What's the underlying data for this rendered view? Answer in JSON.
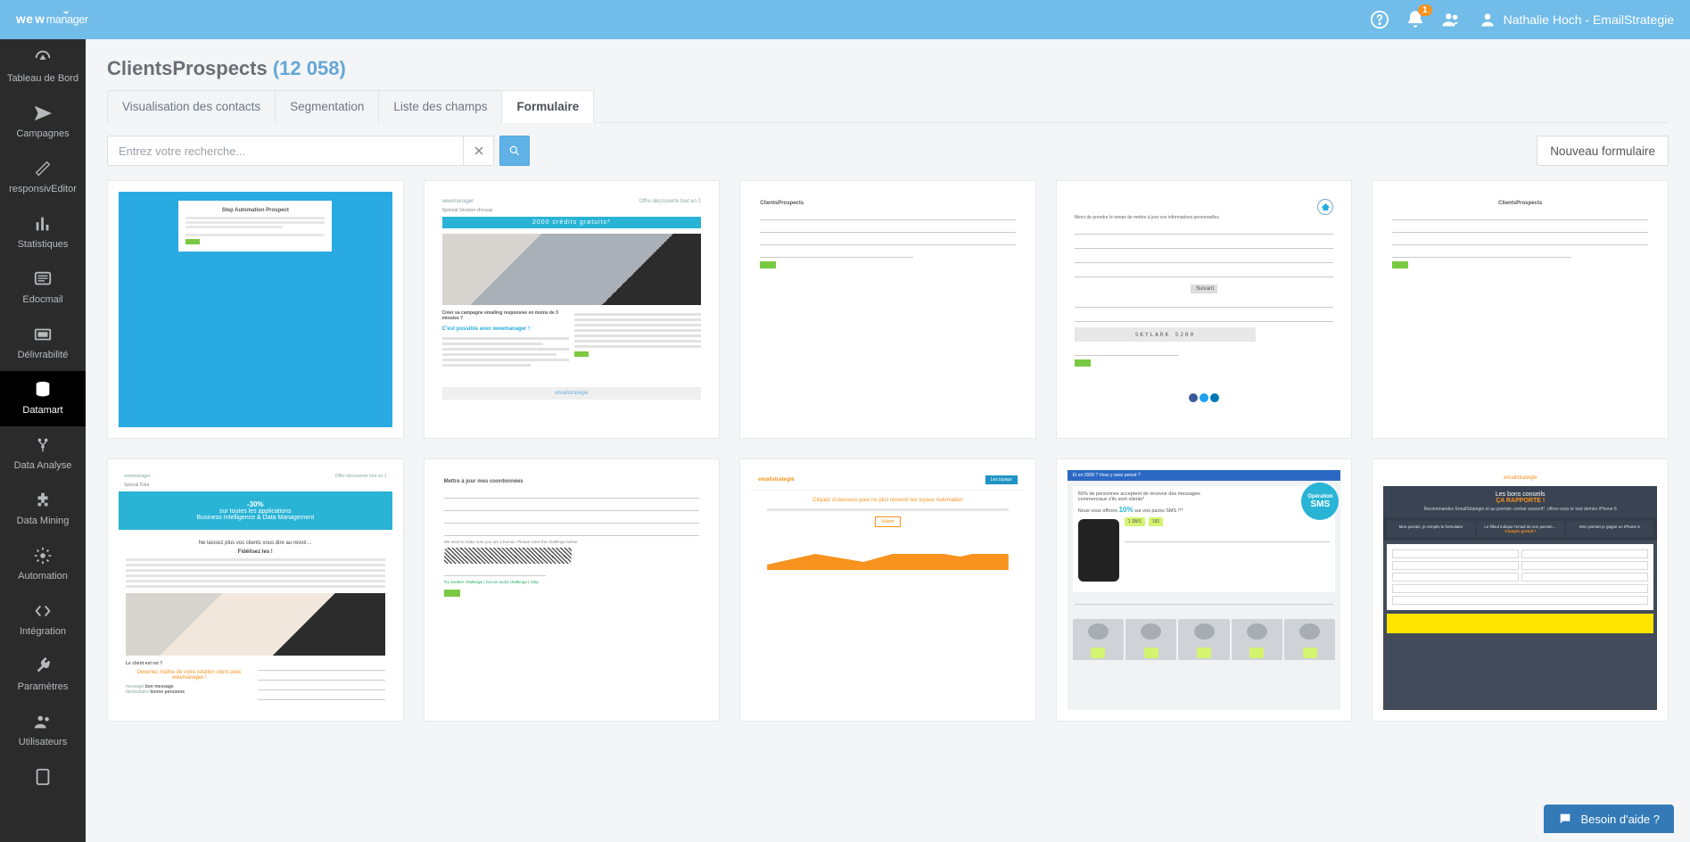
{
  "brand": "wewmanager",
  "user": {
    "name": "Nathalie Hoch - EmailStrategie"
  },
  "notifications": {
    "badge": "1"
  },
  "sidebar": {
    "items": [
      {
        "label": "Tableau de Bord"
      },
      {
        "label": "Campagnes"
      },
      {
        "label": "responsivEditor"
      },
      {
        "label": "Statistiques"
      },
      {
        "label": "Edocmail"
      },
      {
        "label": "Délivrabilité"
      },
      {
        "label": "Datamart"
      },
      {
        "label": "Data Analyse"
      },
      {
        "label": "Data Mining"
      },
      {
        "label": "Automation"
      },
      {
        "label": "Intégration"
      },
      {
        "label": "Paramètres"
      },
      {
        "label": "Utilisateurs"
      }
    ],
    "activeIndex": 6
  },
  "page": {
    "title": "ClientsProspects",
    "count": "(12 058)",
    "tabs": [
      "Visualisation des contacts",
      "Segmentation",
      "Liste des champs",
      "Formulaire"
    ],
    "activeTab": 3
  },
  "search": {
    "placeholder": "Entrez votre recherche..."
  },
  "buttons": {
    "new_form": "Nouveau formulaire"
  },
  "help": {
    "label": "Besoin d'aide ?"
  },
  "thumbs": {
    "t1_title": "Step Automation Prospect",
    "t2_header_left": "wewmanager",
    "t2_header_right": "Offre découverte tout en 1",
    "t2_band": "2000 crédits gratuits*",
    "t2_cta": "C'est possible avec wewmanager !",
    "t2_sub": "Créer sa campagne emailing responsive en moins de 3 minutes ?",
    "t2_foot": "emailstrategie",
    "t3_title": "ClientsProspects",
    "t4_btn": "Suivant",
    "t4_cap": "SKYLARK 5200",
    "t5_title": "ClientsProspects",
    "t6_discount": "-30%",
    "t6_line1": "sur toutes les applications",
    "t6_line2": "Business Intelligence & Data Management",
    "t6_sub1": "Ne laissez plus vos clients vous dire au revoir…",
    "t6_sub2": "Fidélisez les !",
    "t6_cta1": "Le client est roi ?",
    "t6_cta2": "Devenez maître de votre relation client avec wewmanager !",
    "t6_cta3": "bon message",
    "t6_cta4": "bonne personne",
    "t7_title": "Mettre à jour mes coordonnées",
    "t8_logo": "emailstrategie",
    "t8_tag": "Les tuyaux",
    "t8_line": "Cliquez ci-dessous pour ne plus recevoir les tuyaux Automation",
    "t9_bar": "Et en 2008 ? Vous y avez pensé ?",
    "t9_txt1": "65% de personnes acceptent de recevoir des messages commerciaux s'ils sont clients*",
    "t9_txt2": "Nous vous offrons",
    "t9_pct": "10%",
    "t9_txt3": "sur vos packs SMS !**",
    "t9_sms1": "Opération",
    "t9_sms2": "SMS",
    "t9_chip1": "1 SMS",
    "t9_chip2": "160",
    "t10_head1": "Les bons conseils",
    "t10_head2": "ÇA RAPPORTE !",
    "t10_head3": "Recommandez EmailStrategie et au premier contrat souscrit*, offrez-vous le tout dernier iPhone 6"
  }
}
